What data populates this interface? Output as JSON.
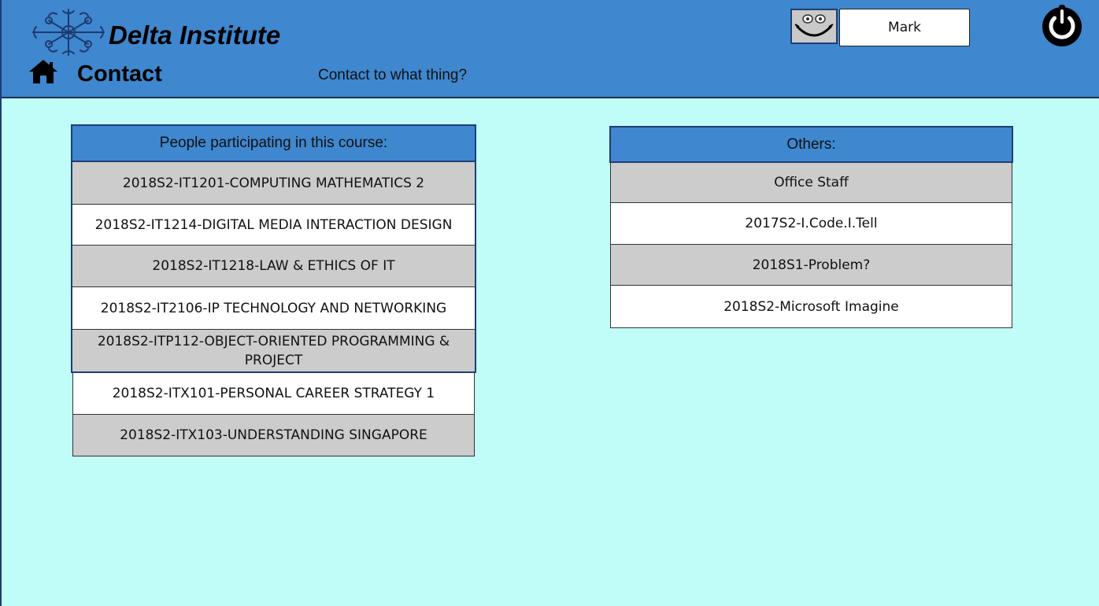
{
  "header": {
    "brand": "Delta Institute",
    "page_title": "Contact",
    "subtitle": "Contact to what thing?",
    "username": "Mark",
    "colors": {
      "header_bg": "#3f87cf",
      "page_bg": "#c0fcf8",
      "row_gray": "#cccccc",
      "border_dark": "#1f3e74"
    },
    "icons": {
      "logo": "snowflake-logo-icon",
      "home": "home-icon",
      "avatar": "smiley-avatar-icon",
      "power": "power-icon"
    }
  },
  "course_panel": {
    "header": "People participating in this course:",
    "items": [
      "2018S2-IT1201-COMPUTING MATHEMATICS 2",
      "2018S2-IT1214-DIGITAL MEDIA INTERACTION DESIGN",
      "2018S2-IT1218-LAW & ETHICS OF IT",
      "2018S2-IT2106-IP TECHNOLOGY AND NETWORKING",
      "2018S2-ITP112-OBJECT-ORIENTED PROGRAMMING & PROJECT",
      "2018S2-ITX101-PERSONAL CAREER STRATEGY 1",
      "2018S2-ITX103-UNDERSTANDING SINGAPORE"
    ]
  },
  "others_panel": {
    "header": "Others:",
    "items": [
      "Office Staff",
      "2017S2-I.Code.I.Tell",
      "2018S1-Problem?",
      "2018S2-Microsoft Imagine"
    ]
  }
}
